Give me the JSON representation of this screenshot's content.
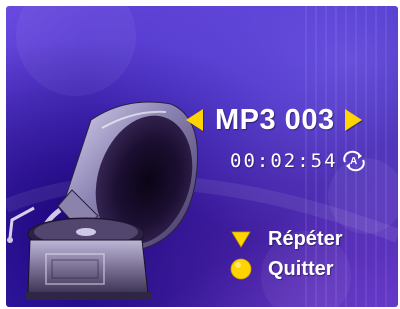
{
  "player": {
    "track_title": "MP3 003",
    "elapsed_time": "00:02:54",
    "repeat_mode_badge": "A"
  },
  "menu": {
    "items": [
      {
        "label": "Répéter",
        "icon": "triangle-down-icon",
        "color": "#ffd400"
      },
      {
        "label": "Quitter",
        "icon": "circle-icon",
        "color": "#ffd400"
      }
    ]
  },
  "icons": {
    "prev": "triangle-left-icon",
    "next": "triangle-right-icon",
    "artwork": "gramophone-icon",
    "repeat": "repeat-icon"
  },
  "colors": {
    "accent": "#ffd400",
    "background": "#3b23ba",
    "text": "#ffffff"
  }
}
